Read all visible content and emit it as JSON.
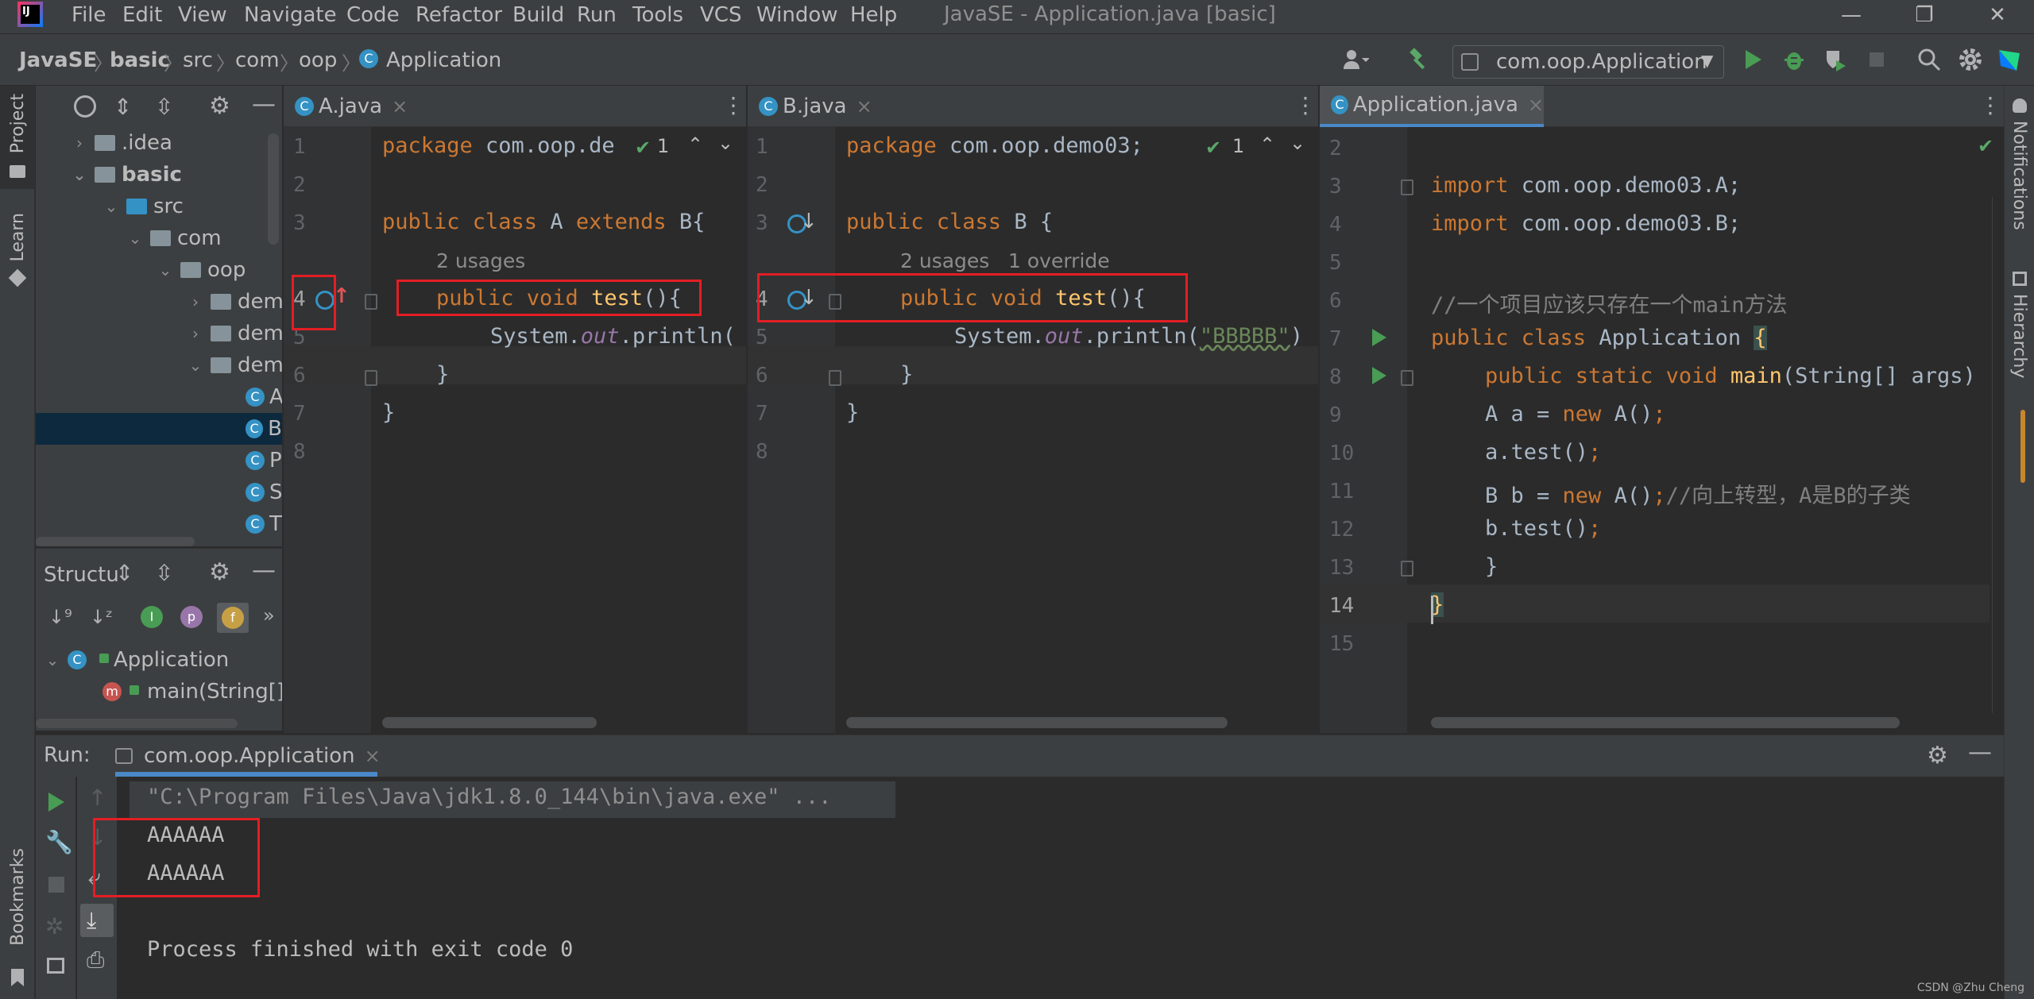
{
  "menubar": {
    "items": [
      "File",
      "Edit",
      "View",
      "Navigate",
      "Code",
      "Refactor",
      "Build",
      "Run",
      "Tools",
      "VCS",
      "Window",
      "Help"
    ],
    "window_title": "JavaSE - Application.java [basic]",
    "minimize": "—",
    "maximize": "❐",
    "close": "✕"
  },
  "navbar": {
    "breadcrumbs": [
      "JavaSE",
      "basic",
      "src",
      "com",
      "oop",
      "Application"
    ],
    "run_config": "com.oop.Application"
  },
  "left_stripe": {
    "project": "Project",
    "learn": "Learn",
    "bookmarks": "Bookmarks"
  },
  "right_stripe": {
    "notifications": "Notifications",
    "hierarchy": "Hierarchy"
  },
  "project_tree": [
    {
      "label": ".idea",
      "type": "folder"
    },
    {
      "label": "basic",
      "type": "module"
    },
    {
      "label": "src",
      "type": "source"
    },
    {
      "label": "com",
      "type": "package"
    },
    {
      "label": "oop",
      "type": "package"
    },
    {
      "label": "dem",
      "type": "package"
    },
    {
      "label": "dem",
      "type": "package"
    },
    {
      "label": "dem",
      "type": "package"
    },
    {
      "label": "A",
      "type": "class"
    },
    {
      "label": "B",
      "type": "class"
    },
    {
      "label": "P",
      "type": "class"
    },
    {
      "label": "S",
      "type": "class"
    },
    {
      "label": "T",
      "type": "class"
    }
  ],
  "structure": {
    "title": "Structu",
    "badges": [
      "I",
      "p",
      "f"
    ],
    "class_name": "Application",
    "method": "main(String[])"
  },
  "editor_a": {
    "tab": "A.java",
    "inspection": "1",
    "line_numbers": [
      "1",
      "2",
      "3",
      "",
      "4",
      "5",
      "6",
      "7",
      "8"
    ],
    "usages": "2 usages",
    "lines": {
      "l1_kw": "package ",
      "l1_rest": "com.oop.de",
      "l3_kw1": "public class ",
      "l3_name": "A ",
      "l3_kw2": "extends ",
      "l3_rest": "B{",
      "l4_kw": "public void ",
      "l4_fn": "test",
      "l4_rest": "(){",
      "l5_a": "System.",
      "l5_st": "out",
      "l5_b": ".println(",
      "l6": "}",
      "l7": "}"
    }
  },
  "editor_b": {
    "tab": "B.java",
    "inspection": "1",
    "line_numbers": [
      "1",
      "2",
      "3",
      "",
      "4",
      "5",
      "6",
      "7",
      "8"
    ],
    "usages": "2 usages",
    "override": "1 override",
    "lines": {
      "l1_kw": "package ",
      "l1_rest": "com.oop.demo03;",
      "l3_kw": "public class ",
      "l3_rest": "B {",
      "l4_kw": "public void ",
      "l4_fn": "test",
      "l4_rest": "(){",
      "l5_a": "System.",
      "l5_st": "out",
      "l5_b": ".println(",
      "l5_str": "\"BBBBB\"",
      "l5_c": ")",
      "l6": "}",
      "l7": "}"
    }
  },
  "editor_app": {
    "tab": "Application.java",
    "line_numbers": [
      "2",
      "3",
      "4",
      "5",
      "6",
      "7",
      "8",
      "9",
      "10",
      "11",
      "12",
      "13",
      "14",
      "15"
    ],
    "lines": {
      "l3_kw": "import ",
      "l3_rest": "com.oop.demo03.A;",
      "l4_kw": "import ",
      "l4_rest": "com.oop.demo03.B;",
      "l6_cmt": "//一个项目应该只存在一个main方法",
      "l7_kw": "public class ",
      "l7_rest": "Application ",
      "l7_brace": "{",
      "l8_kw": "public static void ",
      "l8_fn": "main",
      "l8_rest": "(String[] args)",
      "l9_a": "A a = ",
      "l9_kw": "new ",
      "l9_b": "A()",
      "l9_semi": ";",
      "l10_a": "a.test()",
      "l10_semi": ";",
      "l11_a": "B b = ",
      "l11_kw": "new ",
      "l11_b": "A()",
      "l11_semi": ";",
      "l11_cmt": "//向上转型，A是B的子类",
      "l12_a": "b.test()",
      "l12_semi": ";",
      "l13": "}",
      "l14": "}"
    }
  },
  "run": {
    "label": "Run:",
    "tab": "com.oop.Application",
    "command": "\"C:\\Program Files\\Java\\jdk1.8.0_144\\bin\\java.exe\" ...",
    "output": [
      "AAAAAA",
      "AAAAAA"
    ],
    "finished": "Process finished with exit code 0"
  },
  "watermark": "CSDN @Zhu Cheng",
  "colors": {
    "keyword": "#cc7832",
    "function": "#ffc66d",
    "string": "#6a8759",
    "comment": "#808080",
    "highlight_box": "#e31e24",
    "accent": "#4a88c7"
  }
}
